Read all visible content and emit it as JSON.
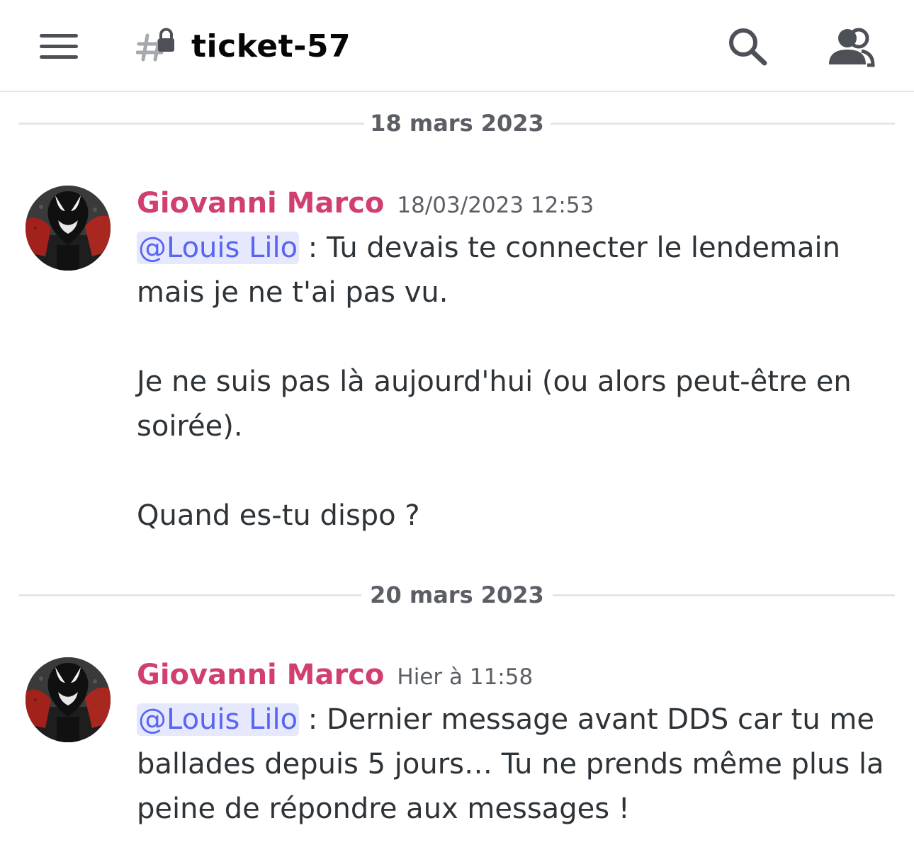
{
  "header": {
    "menu_icon": "hamburger-menu-icon",
    "channel_icon": "locked-hash-channel-icon",
    "channel_name": "ticket-57",
    "search_icon": "search-icon",
    "members_icon": "members-icon"
  },
  "dividers": [
    {
      "label": "18 mars 2023"
    },
    {
      "label": "20 mars 2023"
    }
  ],
  "messages": [
    {
      "author": "Giovanni Marco",
      "timestamp": "18/03/2023 12:53",
      "mention": "@Louis Lilo",
      "paragraphs": [
        " : Tu devais te connecter le lendemain mais je ne t'ai pas vu.",
        "Je ne suis pas là aujourd'hui (ou alors peut-être en soirée).",
        "Quand es-tu dispo ?"
      ]
    },
    {
      "author": "Giovanni Marco",
      "timestamp": "Hier à 11:58",
      "mention": "@Louis Lilo",
      "paragraphs": [
        " : Dernier message avant DDS car tu me ballades depuis 5 jours… Tu ne prends même plus la peine de répondre aux messages !"
      ]
    }
  ],
  "colors": {
    "author": "#d13f6f",
    "mention_text": "#5865f2",
    "mention_bg": "#e6e8fd",
    "divider": "#e3e5e8"
  }
}
